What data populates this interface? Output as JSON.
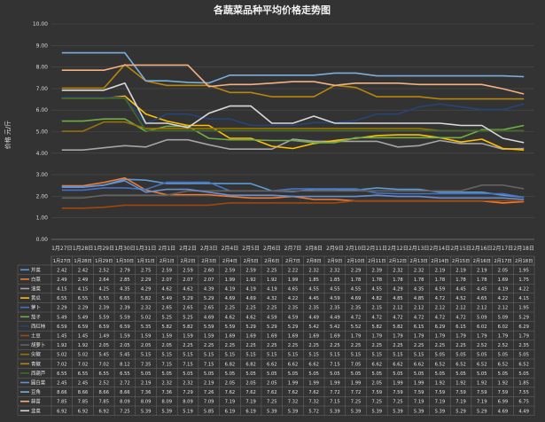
{
  "chart_data": {
    "type": "line",
    "title": "各蔬菜品种平均价格走势图",
    "ylabel": "价格 元/斤",
    "ylim": [
      0,
      10
    ],
    "yticks": [
      "0.00",
      "1.00",
      "2.00",
      "3.00",
      "4.00",
      "5.00",
      "6.00",
      "7.00",
      "8.00",
      "9.00",
      "10.00"
    ],
    "grid": true,
    "legend": "table-bottom",
    "categories": [
      "1月27日",
      "1月28日",
      "1月29日",
      "1月30日",
      "1月31日",
      "2月1日",
      "2月2日",
      "2月3日",
      "2月4日",
      "2月5日",
      "2月6日",
      "2月7日",
      "2月8日",
      "2月9日",
      "2月10日",
      "2月11日",
      "2月12日",
      "2月13日",
      "2月14日",
      "2月15日",
      "2月16日",
      "2月17日",
      "2月18日"
    ],
    "series": [
      {
        "name": "芹菜",
        "color": "#5b9bd5",
        "values": [
          2.42,
          2.42,
          2.52,
          2.79,
          2.75,
          2.59,
          2.59,
          2.6,
          2.59,
          2.59,
          2.25,
          2.22,
          2.32,
          2.32,
          2.29,
          2.39,
          2.32,
          2.32,
          2.19,
          2.19,
          2.19,
          2.05,
          1.95
        ]
      },
      {
        "name": "白菜",
        "color": "#ed7d31",
        "values": [
          2.49,
          2.49,
          2.64,
          2.85,
          2.29,
          2.07,
          2.07,
          2.07,
          1.99,
          1.92,
          1.92,
          1.99,
          1.85,
          1.85,
          1.78,
          1.78,
          1.78,
          1.78,
          1.78,
          1.78,
          1.78,
          1.69,
          1.75
        ]
      },
      {
        "name": "油菜",
        "color": "#a5a5a5",
        "values": [
          4.15,
          4.15,
          4.25,
          4.35,
          4.29,
          4.62,
          4.62,
          4.39,
          4.19,
          4.19,
          4.19,
          4.65,
          4.55,
          4.55,
          4.55,
          4.55,
          4.29,
          4.35,
          4.59,
          4.45,
          4.45,
          4.19,
          4.22
        ]
      },
      {
        "name": "黄瓜",
        "color": "#ffc000",
        "values": [
          6.55,
          6.55,
          6.55,
          6.65,
          5.82,
          5.49,
          5.29,
          5.29,
          4.69,
          4.69,
          4.32,
          4.22,
          4.45,
          4.59,
          4.69,
          4.82,
          4.85,
          4.85,
          4.72,
          4.52,
          4.65,
          4.22,
          4.15
        ]
      },
      {
        "name": "萝卜",
        "color": "#4472c4",
        "values": [
          2.29,
          2.29,
          2.39,
          2.39,
          2.32,
          2.65,
          2.65,
          2.65,
          2.25,
          2.25,
          2.25,
          2.35,
          2.35,
          2.35,
          2.35,
          2.15,
          2.12,
          2.12,
          2.12,
          2.12,
          2.12,
          2.12,
          1.95
        ]
      },
      {
        "name": "茄子",
        "color": "#70ad47",
        "values": [
          5.49,
          5.49,
          5.59,
          5.59,
          5.02,
          5.25,
          5.25,
          4.69,
          4.62,
          4.62,
          4.59,
          4.59,
          4.49,
          4.49,
          4.72,
          4.72,
          4.72,
          4.72,
          4.72,
          4.72,
          5.09,
          5.09,
          5.29
        ]
      },
      {
        "name": "西红柿",
        "color": "#264478",
        "values": [
          6.59,
          6.59,
          6.59,
          6.59,
          5.35,
          5.82,
          5.82,
          5.59,
          5.59,
          5.29,
          5.29,
          5.29,
          5.42,
          5.42,
          5.52,
          5.82,
          5.82,
          6.15,
          6.29,
          6.15,
          6.02,
          6.02,
          6.29
        ]
      },
      {
        "name": "土豆",
        "color": "#9e480e",
        "values": [
          1.45,
          1.45,
          1.49,
          1.59,
          1.59,
          1.59,
          1.59,
          1.59,
          1.69,
          1.69,
          1.69,
          1.69,
          1.69,
          1.69,
          1.79,
          1.79,
          1.79,
          1.79,
          1.79,
          1.79,
          1.79,
          1.79,
          1.79
        ]
      },
      {
        "name": "胡萝卜",
        "color": "#636363",
        "values": [
          1.92,
          1.92,
          2.05,
          2.05,
          2.05,
          2.05,
          2.25,
          2.25,
          2.25,
          2.25,
          2.25,
          2.25,
          2.25,
          2.25,
          2.25,
          2.25,
          2.25,
          2.25,
          2.25,
          2.25,
          2.52,
          2.52,
          2.35
        ]
      },
      {
        "name": "尖椒",
        "color": "#997300",
        "values": [
          5.02,
          5.02,
          5.45,
          5.45,
          5.15,
          5.15,
          5.15,
          5.15,
          5.15,
          5.15,
          5.15,
          5.15,
          5.15,
          5.15,
          5.15,
          5.15,
          5.15,
          5.15,
          5.05,
          5.05,
          5.05,
          5.05,
          5.05
        ]
      },
      {
        "name": "青椒",
        "color": "#b8860b",
        "values": [
          7.02,
          7.02,
          7.02,
          8.12,
          7.35,
          7.15,
          7.15,
          7.15,
          6.82,
          6.82,
          6.62,
          6.62,
          6.62,
          7.15,
          7.05,
          6.62,
          6.62,
          6.62,
          6.52,
          6.52,
          6.52,
          6.52,
          6.52
        ]
      },
      {
        "name": "西葫芦",
        "color": "#43682b",
        "values": [
          6.55,
          6.55,
          6.55,
          6.55,
          5.05,
          5.05,
          5.05,
          5.05,
          5.05,
          5.05,
          5.05,
          5.05,
          5.05,
          5.05,
          5.05,
          5.05,
          5.05,
          5.05,
          5.05,
          5.05,
          5.05,
          5.05,
          5.05
        ]
      },
      {
        "name": "圆白菜",
        "color": "#698ed0",
        "values": [
          2.45,
          2.45,
          2.52,
          2.72,
          2.19,
          2.32,
          2.32,
          2.19,
          2.05,
          2.05,
          2.05,
          1.99,
          1.99,
          1.99,
          1.99,
          2.05,
          1.99,
          1.99,
          1.92,
          1.92,
          1.92,
          1.92,
          1.85
        ]
      },
      {
        "name": "豆角",
        "color": "#7cafdd",
        "values": [
          8.66,
          8.66,
          8.66,
          8.66,
          7.36,
          7.36,
          7.29,
          7.26,
          7.62,
          7.62,
          7.62,
          7.62,
          7.62,
          7.72,
          7.72,
          7.59,
          7.59,
          7.59,
          7.59,
          7.59,
          7.59,
          7.59,
          7.55
        ]
      },
      {
        "name": "蒜苗",
        "color": "#f4b183",
        "values": [
          7.85,
          7.85,
          7.85,
          8.09,
          8.09,
          8.09,
          8.09,
          7.09,
          7.19,
          7.19,
          7.25,
          7.32,
          7.32,
          7.15,
          7.25,
          7.25,
          7.25,
          7.19,
          7.19,
          7.19,
          7.19,
          6.99,
          6.75
        ]
      },
      {
        "name": "韭菜",
        "color": "#d9d9d9",
        "values": [
          6.92,
          6.92,
          6.92,
          7.25,
          5.39,
          5.39,
          5.19,
          5.85,
          6.19,
          6.19,
          5.39,
          5.39,
          5.72,
          5.39,
          5.39,
          5.39,
          5.39,
          5.39,
          5.39,
          5.29,
          5.29,
          4.69,
          4.49
        ]
      }
    ]
  }
}
